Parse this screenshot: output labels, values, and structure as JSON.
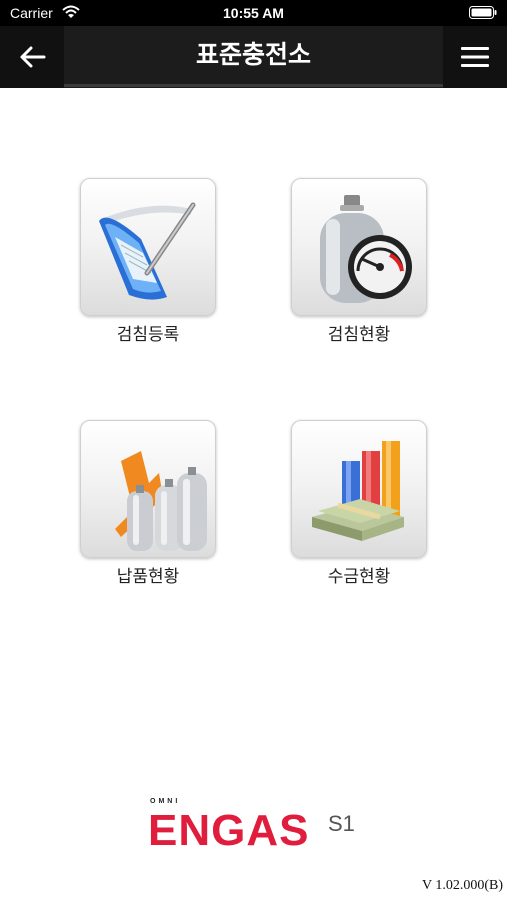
{
  "status_bar": {
    "carrier": "Carrier",
    "time": "10:55 AM"
  },
  "nav": {
    "title": "표준충전소",
    "back_icon": "arrow-left-icon",
    "menu_icon": "hamburger-menu-icon"
  },
  "menu": [
    {
      "label": "검침등록",
      "icon": "handheld-terminal-icon"
    },
    {
      "label": "검침현황",
      "icon": "gas-cylinder-gauge-icon"
    },
    {
      "label": "납품현황",
      "icon": "delivery-cylinders-chart-icon"
    },
    {
      "label": "수금현황",
      "icon": "money-bar-chart-icon"
    }
  ],
  "brand": {
    "small": "OMNI",
    "name": "ENGAS",
    "suffix": "S1",
    "color": "#e11d3d"
  },
  "version": "V 1.02.000(B)"
}
